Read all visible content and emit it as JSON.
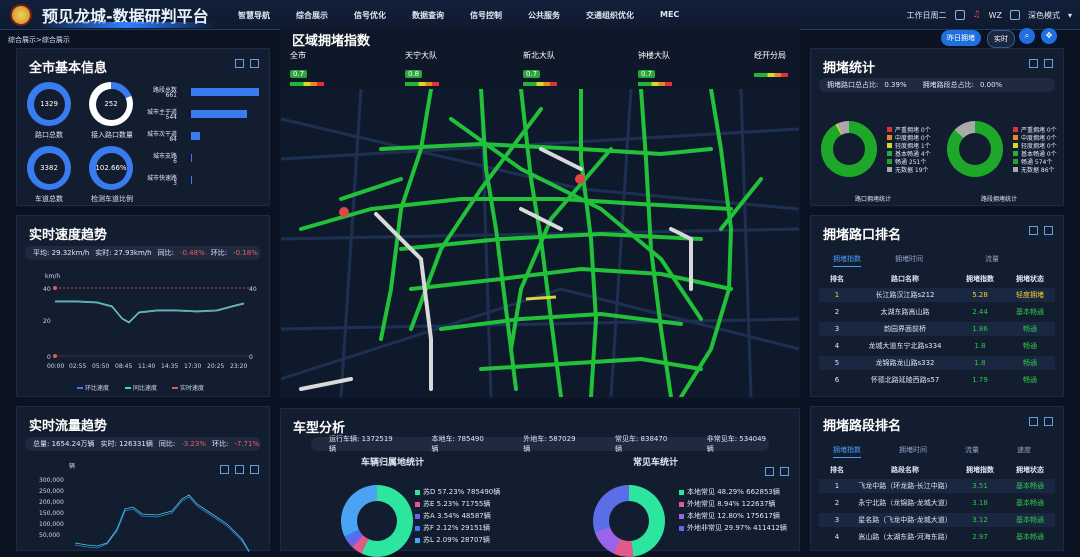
{
  "header": {
    "title": "预见龙城-数据研判平台",
    "nav": [
      "智慧导航",
      "综合展示",
      "信号优化",
      "数据查询",
      "信号控制",
      "公共服务",
      "交通组织优化",
      "MEC"
    ],
    "workday": "工作日周二",
    "user": "WZ",
    "theme": "深色模式"
  },
  "breadcrumb": "综合展示>综合展示",
  "city": {
    "title": "全市基本信息",
    "rings": [
      {
        "value": "1329",
        "label": "路口总数",
        "pct": 100
      },
      {
        "value": "252",
        "label": "接入路口数量",
        "pct": 19
      },
      {
        "value": "3382",
        "label": "车道总数",
        "pct": 100
      },
      {
        "value": "102.66%",
        "label": "检测车道比例",
        "pct": 100
      }
    ],
    "roads": [
      {
        "label": "路段总数",
        "value": "661",
        "pct": 100
      },
      {
        "label": "城市主干道",
        "value": "544",
        "pct": 82
      },
      {
        "label": "城市次干道",
        "value": "84",
        "pct": 13
      },
      {
        "label": "城市支路",
        "value": "6",
        "pct": 1
      },
      {
        "label": "城市快速路",
        "value": "3",
        "pct": 0.5
      }
    ]
  },
  "speed": {
    "title": "实时速度趋势",
    "avg_label": "平均: 29.32km/h",
    "rt_label": "实时: 27.93km/h",
    "yoy_label": "同比:",
    "yoy": "-0.48%",
    "mom_label": "环比:",
    "mom": "-0.18%",
    "unit": "km/h",
    "yticks": [
      "40",
      "20",
      "0"
    ],
    "xticks": [
      "00:00",
      "02:55",
      "05:50",
      "08:45",
      "11:40",
      "14:35",
      "17:30",
      "20:25",
      "23:20"
    ],
    "marker_start": "40",
    "marker_end": "40",
    "marker_end0": "0",
    "legend": [
      "环比速度",
      "同比速度",
      "实时速度"
    ]
  },
  "flow": {
    "title": "实时流量趋势",
    "total_label": "总量: 1654.24万辆",
    "rt_label": "实时: 126331辆",
    "yoy_label": "同比:",
    "yoy": "-3.23%",
    "mom_label": "环比:",
    "mom": "-7.71%",
    "unit": "辆",
    "yticks": [
      "300,000",
      "250,000",
      "200,000",
      "150,000",
      "100,000",
      "50,000"
    ]
  },
  "congestion": {
    "title": "区域拥堵指数",
    "areas": [
      {
        "name": "全市",
        "value": "0.7"
      },
      {
        "name": "天宁大队",
        "value": "0.8"
      },
      {
        "name": "新北大队",
        "value": "0.7"
      },
      {
        "name": "钟楼大队",
        "value": "0.7"
      },
      {
        "name": "经开分局",
        "value": ""
      }
    ],
    "btn_yesterday": "昨日拥堵",
    "btn_rt": "实时"
  },
  "stats": {
    "title": "拥堵统计",
    "cross_label": "拥堵路口总占比:",
    "cross_val": "0.39%",
    "road_label": "拥堵路段总占比:",
    "road_val": "0.00%",
    "legend1": [
      "严重拥堵 0个",
      "中度拥堵 0个",
      "轻度拥堵 1个",
      "基本畅通 4个",
      "畅通 251个",
      "无数据 19个"
    ],
    "legend2": [
      "严重拥堵 0个",
      "中度拥堵 0个",
      "轻度拥堵 0个",
      "基本畅通 0个",
      "畅通 574个",
      "无数据 86个"
    ],
    "cap1": "路口拥堵统计",
    "cap2": "路段拥堵统计",
    "colors": [
      "#e03434",
      "#e38a27",
      "#d7d72a",
      "#23b23a",
      "#1ea82a",
      "#a9a9a9"
    ]
  },
  "cross_rank": {
    "title": "拥堵路口排名",
    "tabs": [
      "拥堵指数",
      "拥堵时间",
      "流量"
    ],
    "headers": [
      "排名",
      "路口名称",
      "拥堵指数",
      "拥堵状态"
    ],
    "rows": [
      {
        "r": "1",
        "n": "长江路汉江路s212",
        "v": "5.28",
        "s": "轻度拥堵"
      },
      {
        "r": "2",
        "n": "太湖东路嵩山路",
        "v": "2.44",
        "s": "基本畅通"
      },
      {
        "r": "3",
        "n": "韵园界面前桥",
        "v": "1.86",
        "s": "畅通"
      },
      {
        "r": "4",
        "n": "龙城大道东宁北路s334",
        "v": "1.8",
        "s": "畅通"
      },
      {
        "r": "5",
        "n": "龙锦路龙山路s332",
        "v": "1.8",
        "s": "畅通"
      },
      {
        "r": "6",
        "n": "怀德北路延陵西路s57",
        "v": "1.79",
        "s": "畅通"
      }
    ]
  },
  "road_rank": {
    "title": "拥堵路段排名",
    "tabs": [
      "拥堵指数",
      "拥堵时间",
      "流量",
      "速度"
    ],
    "headers": [
      "排名",
      "路段名称",
      "拥堵指数",
      "拥堵状态"
    ],
    "rows": [
      {
        "r": "1",
        "n": "飞龙中路（环龙路-长江中路）",
        "v": "3.51",
        "s": "基本畅通"
      },
      {
        "r": "2",
        "n": "永宁北路（龙锦路-龙城大道）",
        "v": "3.18",
        "s": "基本畅通"
      },
      {
        "r": "3",
        "n": "星名路（飞龙中路-龙城大道）",
        "v": "3.12",
        "s": "基本畅通"
      },
      {
        "r": "4",
        "n": "嵩山路（太湖东路-河海东路）",
        "v": "2.97",
        "s": "基本畅通"
      }
    ]
  },
  "vehicle": {
    "title": "车型分析",
    "op_label": "运行车辆: 1372519辆",
    "local_label": "本地车: 785490辆",
    "out_label": "外地车: 587029辆",
    "common_label": "常见车: 838470辆",
    "uncommon_label": "非常见车: 534049辆",
    "origin_title": "车辆归属地统计",
    "origin": [
      "苏D 57.23% 785490辆",
      "苏E 5.23% 71755辆",
      "苏A 3.54% 48587辆",
      "苏F 2.12% 29151辆",
      "苏L 2.09% 28707辆"
    ],
    "common_title": "常见车统计",
    "common": [
      "本地常见 48.29% 662853辆",
      "外地常见 8.94% 122637辆",
      "本地常见 12.80% 175617辆",
      "外地非常见 29.97% 411412辆"
    ]
  }
}
